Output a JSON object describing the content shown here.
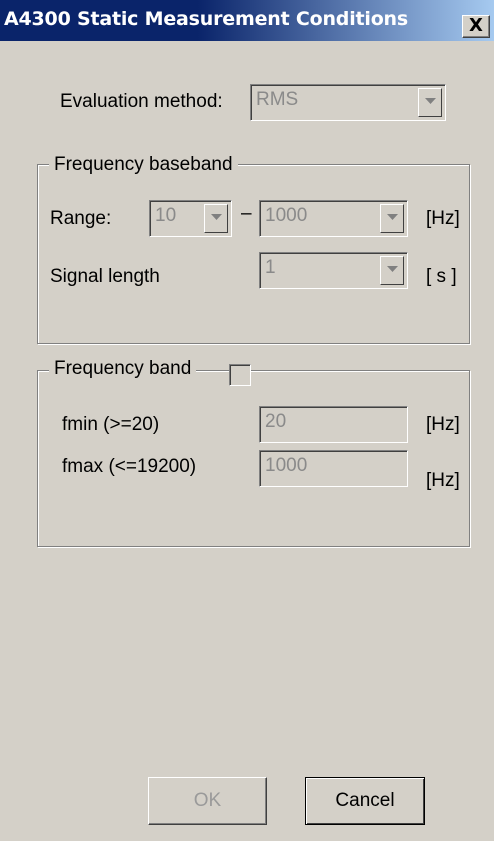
{
  "window": {
    "title": "A4300 Static Measurement Conditions",
    "close_label": "X"
  },
  "evaluation": {
    "label": "Evaluation method:",
    "value": "RMS"
  },
  "baseband": {
    "group_title": "Frequency baseband",
    "range_label": "Range:",
    "range_from": "10",
    "range_dash": "–",
    "range_to": "1000",
    "range_unit": "[Hz]",
    "signal_length_label": "Signal length",
    "signal_length_value": "1",
    "signal_length_unit": "[ s ]"
  },
  "band": {
    "group_title": "Frequency band",
    "checked": false,
    "fmin_label": "fmin  (>=20)",
    "fmin_value": "20",
    "fmin_unit": "[Hz]",
    "fmax_label": "fmax  (<=19200)",
    "fmax_value": "1000",
    "fmax_unit": "[Hz]"
  },
  "buttons": {
    "ok_label": "OK",
    "cancel_label": "Cancel"
  }
}
